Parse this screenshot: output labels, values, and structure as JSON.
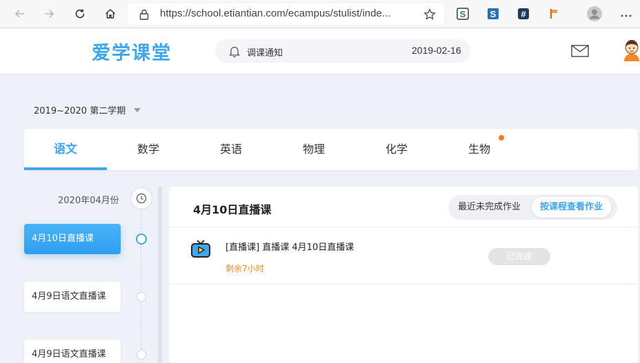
{
  "browser": {
    "url": "https://school.etiantian.com/ecampus/stulist/inde...",
    "extensions": [
      "s-extension-icon",
      "s-square-extension-icon",
      "hash-extension-icon",
      "flag-extension-icon"
    ]
  },
  "header": {
    "logo": "爱学课堂",
    "notice_label": "调课通知",
    "notice_date": "2019-02-16"
  },
  "term": {
    "label": "2019~2020 第二学期"
  },
  "tabs": [
    {
      "label": "语文",
      "active": true
    },
    {
      "label": "数学"
    },
    {
      "label": "英语"
    },
    {
      "label": "物理"
    },
    {
      "label": "化学"
    },
    {
      "label": "生物",
      "has_dot": true
    }
  ],
  "timeline": {
    "month": "2020年04月份",
    "items": [
      {
        "label": "4月10日直播课",
        "active": true
      },
      {
        "label": "4月9日语文直播课"
      },
      {
        "label": "4月9日语文直播课"
      }
    ]
  },
  "panel": {
    "title": "4月10日直播课",
    "toggle": {
      "option_recent": "最近未完成作业",
      "option_by_course": "按课程查看作业"
    },
    "lesson": {
      "title": "[直播课] 直播课 4月10日直播课",
      "remaining": "剩余7小时",
      "status": "已完成"
    }
  },
  "colors": {
    "accent": "#3fa6ea",
    "warning": "#f08a24",
    "dot": "#f57c1f"
  }
}
